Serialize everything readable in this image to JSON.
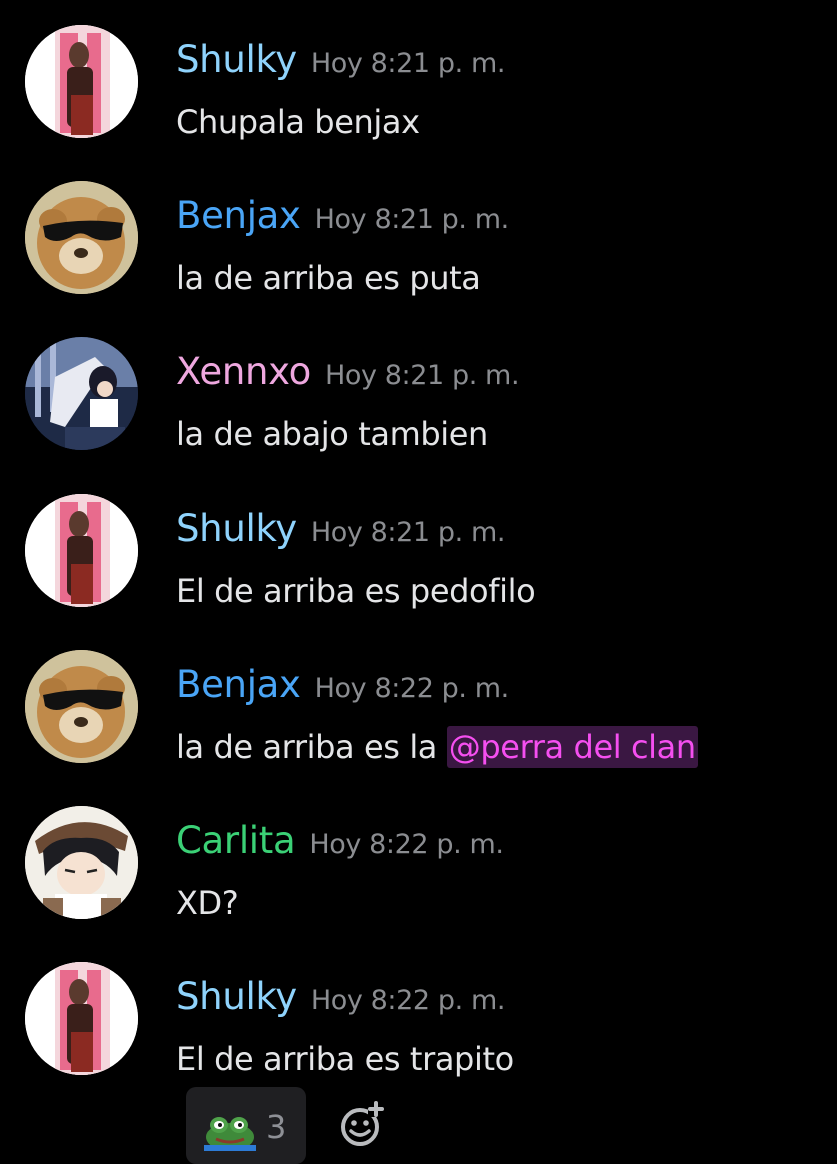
{
  "colors": {
    "shulky": "#8fd3fc",
    "benjax": "#4aa5f6",
    "xennxo": "#eea7df",
    "carlita": "#3bd176",
    "timestamp": "#8b8d91",
    "mention_text": "#f54ff0",
    "mention_bg": "#3a1742"
  },
  "messages": [
    {
      "username": "Shulky",
      "timestamp": "Hoy 8:21 p. m.",
      "text": "Chupala benjax",
      "avatar": "shulky-avatar"
    },
    {
      "username": "Benjax",
      "timestamp": "Hoy 8:21 p. m.",
      "text": "la de arriba es puta",
      "avatar": "benjax-avatar"
    },
    {
      "username": "Xennxo",
      "timestamp": "Hoy 8:21 p. m.",
      "text": "la de abajo tambien",
      "avatar": "xennxo-avatar"
    },
    {
      "username": "Shulky",
      "timestamp": "Hoy 8:21 p. m.",
      "text": "El de arriba es pedofilo",
      "avatar": "shulky-avatar"
    },
    {
      "username": "Benjax",
      "timestamp": "Hoy 8:22 p. m.",
      "text": "la de arriba es la ",
      "mention": "@perra del clan",
      "avatar": "benjax-avatar"
    },
    {
      "username": "Carlita",
      "timestamp": "Hoy 8:22 p. m.",
      "text": "XD?",
      "avatar": "carlita-avatar"
    },
    {
      "username": "Shulky",
      "timestamp": "Hoy 8:22 p. m.",
      "text": "El de arriba es trapito",
      "avatar": "shulky-avatar"
    }
  ],
  "reactions": [
    {
      "emoji": "frog-emoji-icon",
      "count": "3"
    }
  ],
  "add_reaction_icon": "add-reaction-icon"
}
